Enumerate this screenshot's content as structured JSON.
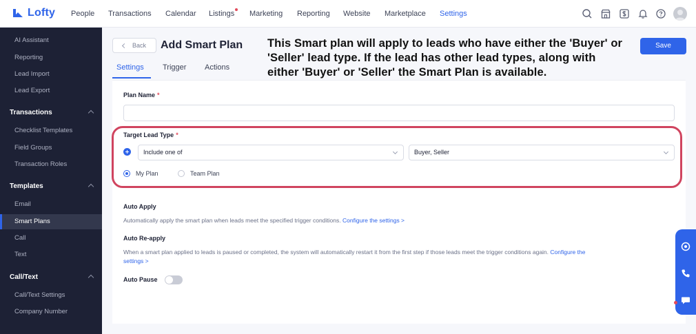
{
  "brand": {
    "name": "Lofty",
    "accent": "#2f64e9"
  },
  "nav": {
    "items": [
      "People",
      "Transactions",
      "Calendar",
      "Listings",
      "Marketing",
      "Reporting",
      "Website",
      "Marketplace",
      "Settings"
    ],
    "active": "Settings",
    "tools": [
      "search-icon",
      "store-icon",
      "dollar-icon",
      "bell-icon",
      "help-icon"
    ]
  },
  "sidebar": {
    "top_items": [
      "AI Assistant",
      "Reporting",
      "Lead Import",
      "Lead Export"
    ],
    "groups": [
      {
        "title": "Transactions",
        "items": [
          "Checklist Templates",
          "Field Groups",
          "Transaction Roles"
        ]
      },
      {
        "title": "Templates",
        "items": [
          "Email",
          "Smart Plans",
          "Call",
          "Text"
        ]
      },
      {
        "title": "Call/Text",
        "items": [
          "Call/Text Settings",
          "Company Number"
        ]
      }
    ],
    "active_item": "Smart Plans"
  },
  "header": {
    "back_label": "Back",
    "title": "Add Smart Plan",
    "save_label": "Save"
  },
  "tabs": [
    "Settings",
    "Trigger",
    "Actions"
  ],
  "form": {
    "plan_name_label": "Plan Name",
    "plan_name_value": "",
    "required_mark": "*",
    "target_lead_type_label": "Target Lead Type",
    "condition_value": "Include one of",
    "lead_types_value": "Buyer, Seller",
    "plan_scope": {
      "option_mine": "My Plan",
      "option_team": "Team Plan",
      "selected": "My Plan"
    },
    "auto_apply": {
      "label": "Auto Apply",
      "desc": "Automatically apply the smart plan when leads meet the specified trigger conditions.",
      "link": "Configure the settings >"
    },
    "auto_reapply": {
      "label": "Auto Re-apply",
      "desc": "When a smart plan applied to leads is paused or completed, the system will automatically restart it from the first step if those leads meet the trigger conditions again.",
      "link_part1": "Configure the",
      "link_part2": "settings >"
    },
    "auto_pause": {
      "label": "Auto Pause",
      "enabled": false
    }
  },
  "annotation": "This Smart plan will apply to leads who have either the 'Buyer' or 'Seller' lead type. If the lead has other lead types, along with either 'Buyer' or 'Seller' the Smart Plan is available.",
  "floating_panel": [
    "location-icon",
    "phone-icon",
    "chat-icon"
  ]
}
